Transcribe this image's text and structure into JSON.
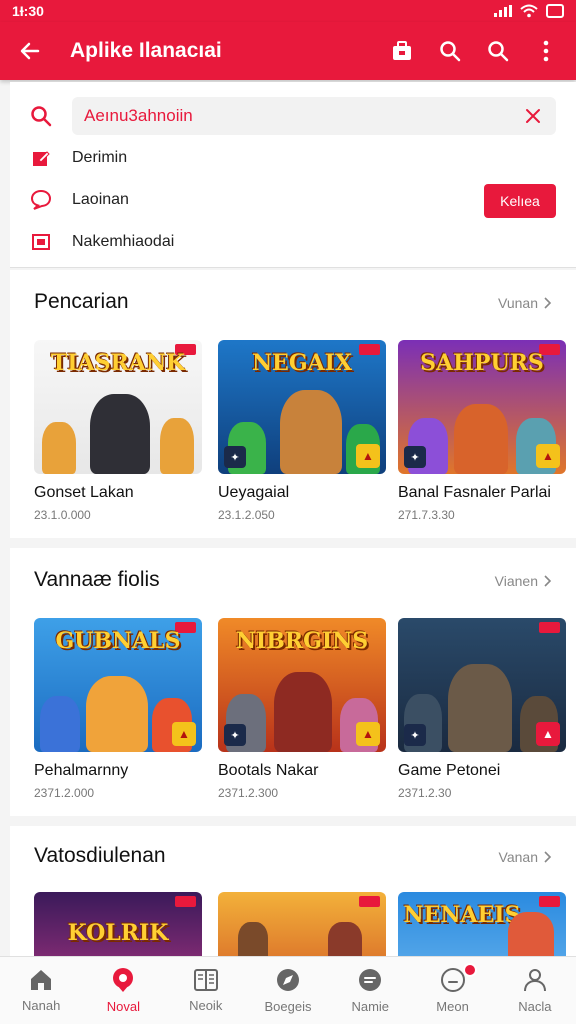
{
  "status": {
    "time": "1Ɨ:30"
  },
  "appbar": {
    "title": "Aplike Ilanacıai"
  },
  "search": {
    "value": "Aeınu3ahnoiin"
  },
  "options": [
    {
      "label": "Derimin",
      "icon": "edit-icon"
    },
    {
      "label": "Laoinan",
      "icon": "chat-bubble-icon"
    },
    {
      "label": "Nakemhiaodai",
      "icon": "image-icon"
    }
  ],
  "action_button": "Kelıea",
  "sections": [
    {
      "title": "Pencarian",
      "more": "Vunan",
      "items": [
        {
          "name": "Gonset Lakan",
          "date": "23.1.0.000",
          "logo": "TIASRANK"
        },
        {
          "name": "Ueyagaial",
          "date": "23.1.2.050",
          "logo": "NEGAIX"
        },
        {
          "name": "Banal Fasnaler Parlai",
          "date": "271.7.3.30",
          "logo": "SAHPURS"
        }
      ]
    },
    {
      "title": "Vannaæ fiolis",
      "more": "Vianen",
      "items": [
        {
          "name": "Pehalmarnny",
          "date": "2371.2.000",
          "logo": "GUBNALS"
        },
        {
          "name": "Bootals Nakar",
          "date": "2371.2.300",
          "logo": "NIBRGINS"
        },
        {
          "name": "Game Petonei",
          "date": "2371.2.30",
          "logo": ""
        }
      ]
    },
    {
      "title": "Vatosdiulenan",
      "more": "Vanan",
      "items": [
        {
          "name": "",
          "date": "",
          "logo": "KOLRIK"
        },
        {
          "name": "",
          "date": "",
          "logo": ""
        },
        {
          "name": "",
          "date": "",
          "logo": "NENAEIS"
        }
      ]
    }
  ],
  "tabs": [
    {
      "label": "Nanah",
      "icon": "home-icon"
    },
    {
      "label": "Noval",
      "icon": "location-pin-icon",
      "active": true
    },
    {
      "label": "Neoik",
      "icon": "book-icon"
    },
    {
      "label": "Boegeis",
      "icon": "compass-icon"
    },
    {
      "label": "Namie",
      "icon": "chat-icon"
    },
    {
      "label": "Meon",
      "icon": "notification-bell-icon",
      "badge": true
    },
    {
      "label": "Nacla",
      "icon": "profile-icon"
    }
  ],
  "colors": {
    "accent": "#e8193c"
  }
}
